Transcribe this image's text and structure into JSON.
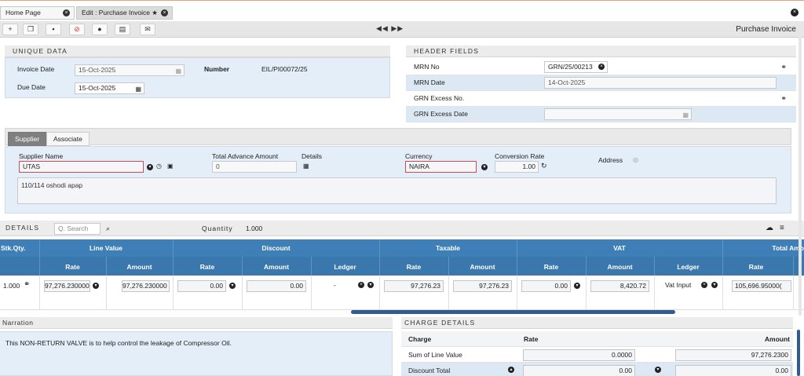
{
  "tabs": [
    {
      "label": "Home Page"
    },
    {
      "label": "Edit : Purchase Invoice ★"
    }
  ],
  "toolbar": {
    "title": "Purchase Invoice",
    "nav": "◀◀ ▶▶"
  },
  "unique": {
    "header": "UNIQUE DATA",
    "invoice_date_label": "Invoice Date",
    "invoice_date": "15-Oct-2025",
    "due_date_label": "Due Date",
    "due_date": "15-Oct-2025",
    "number_label": "Number",
    "number": "EIL/PI00072/25"
  },
  "header_fields": {
    "header": "HEADER FIELDS",
    "mrn_no_label": "MRN No",
    "mrn_no": "GRN/25/00213",
    "mrn_date_label": "MRN Date",
    "mrn_date": "14-Oct-2025",
    "grn_excess_no_label": "GRN Excess No.",
    "grn_excess_date_label": "GRN Excess Date"
  },
  "supplier": {
    "tab_supplier": "Supplier",
    "tab_associate": "Associate",
    "name_label": "Supplier Name",
    "name": "UTAS",
    "advance_label": "Total Advance Amount",
    "advance": "0",
    "details_label": "Details",
    "currency_label": "Currency",
    "currency": "NAIRA",
    "conversion_label": "Conversion Rate",
    "conversion": "1.00",
    "address_label": "Address",
    "address": "110/114 oshodi apap"
  },
  "details": {
    "header": "DETAILS",
    "search_placeholder": "Q. Search",
    "quantity_label": "Quantity",
    "quantity": "1.000",
    "columns": {
      "stk_qty": "Stk.Qty.",
      "line_value": "Line Value",
      "discount": "Discount",
      "taxable": "Taxable",
      "vat": "VAT",
      "total_amount": "Total Amo"
    },
    "subcolumns": {
      "rate": "Rate",
      "amount": "Amount",
      "ledger": "Ledger"
    },
    "row": {
      "stk_qty": "1.000",
      "line_rate": "97,276.230000",
      "line_amount": "97,276.230000",
      "disc_rate": "0.00",
      "disc_amount": "0.00",
      "disc_ledger": "-",
      "tax_rate": "97,276.23",
      "tax_amount": "97,276.23",
      "vat_rate": "0.00",
      "vat_amount": "8,420.72",
      "vat_ledger": "Vat Input",
      "total_rate": "105,696.95000("
    }
  },
  "narration": {
    "header": "Narration",
    "text": "This NON-RETURN VALVE is to help control the leakage of Compressor Oil."
  },
  "charges": {
    "header": "CHARGE DETAILS",
    "col_charge": "Charge",
    "col_rate": "Rate",
    "col_amount": "Amount",
    "rows": [
      {
        "label": "Sum of Line Value",
        "rate": "0.0000",
        "amount": "97,276.2300"
      },
      {
        "label": "Discount Total",
        "rate": "0.00",
        "amount": "0.00"
      }
    ]
  }
}
